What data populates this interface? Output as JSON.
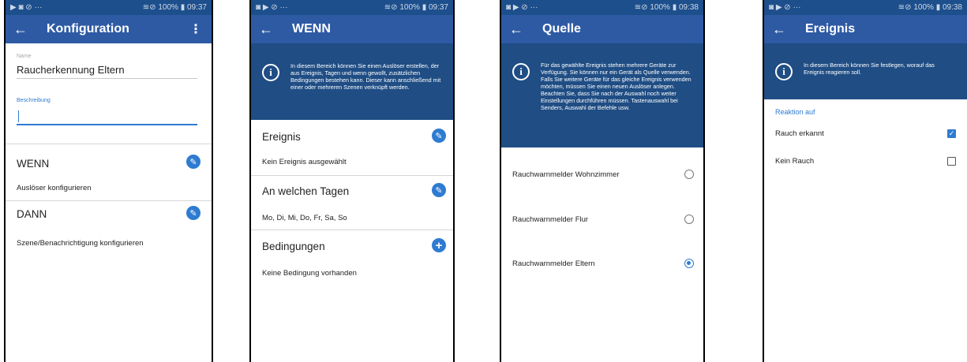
{
  "status": {
    "screen1": {
      "left": "▶ ◙ ⊘ ···",
      "right": "≋⊘ 100% ▮ 09:37"
    },
    "screen2": {
      "left": "◙ ▶ ⊘ ···",
      "right": "≋⊘ 100% ▮ 09:37"
    },
    "screen3": {
      "left": "◙ ▶ ⊘ ···",
      "right": "≋⊘ 100% ▮ 09:38"
    },
    "screen4": {
      "left": "◙ ▶ ⊘ ···",
      "right": "≋⊘ 100% ▮ 09:38"
    }
  },
  "screen1": {
    "title": "Konfiguration",
    "name_label": "Name",
    "name_value": "Raucherkennung Eltern",
    "desc_label": "Beschreibung",
    "desc_value": "",
    "wenn_title": "WENN",
    "wenn_sub": "Auslöser konfigurieren",
    "dann_title": "DANN",
    "dann_sub": "Szene/Benachrichtigung konfigurieren"
  },
  "screen2": {
    "title": "WENN",
    "info": "In diesem Bereich können Sie einen Auslöser erstellen, der aus Ereignis, Tagen und wenn gewollt, zusätzlichen Bedingungen bestehen kann. Dieser kann anschließend mit einer oder mehreren Szenen verknüpft werden.",
    "ereignis_title": "Ereignis",
    "ereignis_value": "Kein Ereignis ausgewählt",
    "tage_title": "An welchen Tagen",
    "tage_value": "Mo, Di, Mi, Do, Fr, Sa, So",
    "bed_title": "Bedingungen",
    "bed_value": "Keine Bedingung vorhanden"
  },
  "screen3": {
    "title": "Quelle",
    "info": "Für das gewählte Ereignis stehen mehrere Geräte zur Verfügung. Sie können nur ein Gerät als Quelle verwenden. Falls Sie weitere Geräte für das gleiche Ereignis verwenden möchten, müssen Sie einen neuen Auslöser anlegen. Beachten Sie, dass Sie nach der Auswahl noch weiter Einstellungen durchführen müssen. Tastenauswahl bei Senders, Auswahl der Befehle usw.",
    "options": [
      "Rauchwarnmelder Wohnzimmer",
      "Rauchwarnmelder Flur",
      "Rauchwarnmelder Eltern"
    ],
    "selected_index": 2
  },
  "screen4": {
    "title": "Ereignis",
    "info": "In diesem Bereich können Sie festlegen, worauf das Ereignis reagieren soll.",
    "section": "Reaktion auf",
    "options": [
      "Rauch erkannt",
      "Kein Rauch"
    ],
    "checked": [
      true,
      false
    ]
  }
}
